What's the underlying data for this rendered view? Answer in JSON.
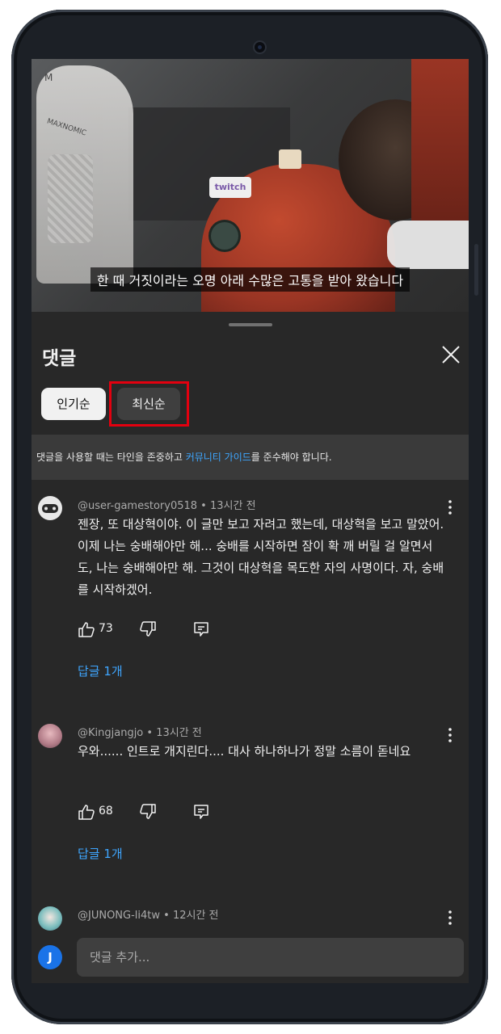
{
  "video": {
    "subtitle": "한 때 거짓이라는 오명 아래 수많은 고통을 받아 왔습니다",
    "chair_logo": "M",
    "chair_brand": "MAXNOMIC",
    "patch_label": "twitch"
  },
  "sheet": {
    "title": "댓글",
    "sort_chips": [
      {
        "label": "인기순",
        "selected": true
      },
      {
        "label": "최신순",
        "selected": false
      }
    ],
    "notice": {
      "before": "댓글을 사용할 때는 타인을 존중하고 ",
      "link": "커뮤니티 가이드",
      "after": "를 준수해야 합니다."
    }
  },
  "comments": [
    {
      "author": "@user-gamestory0518 • 13시간 전",
      "text": "젠장, 또 대상혁이야. 이 글만 보고 자려고 했는데, 대상혁을 보고 말았어. 이제 나는 숭배해야만 해... 숭배를 시작하면 잠이 확 깨 버릴 걸 알면서도, 나는 숭배해야만 해. 그것이 대상혁을 목도한 자의 사명이다. 자, 숭배를 시작하겠어.",
      "likes": "73",
      "replies": "답글 1개"
    },
    {
      "author": "@Kingjangjo • 13시간 전",
      "text": "우와...... 인트로 개지린다.... 대사 하나하나가 정말 소름이 돋네요",
      "likes": "68",
      "replies": "답글 1개"
    },
    {
      "author": "@JUNONG-li4tw • 12시간 전",
      "text": "",
      "likes": "",
      "replies": ""
    }
  ],
  "composer": {
    "avatar_letter": "J",
    "placeholder": "댓글 추가..."
  },
  "colors": {
    "background": "#282828",
    "link": "#3ea6ff",
    "highlight": "#e3000f",
    "avatar": "#1a73e8"
  }
}
